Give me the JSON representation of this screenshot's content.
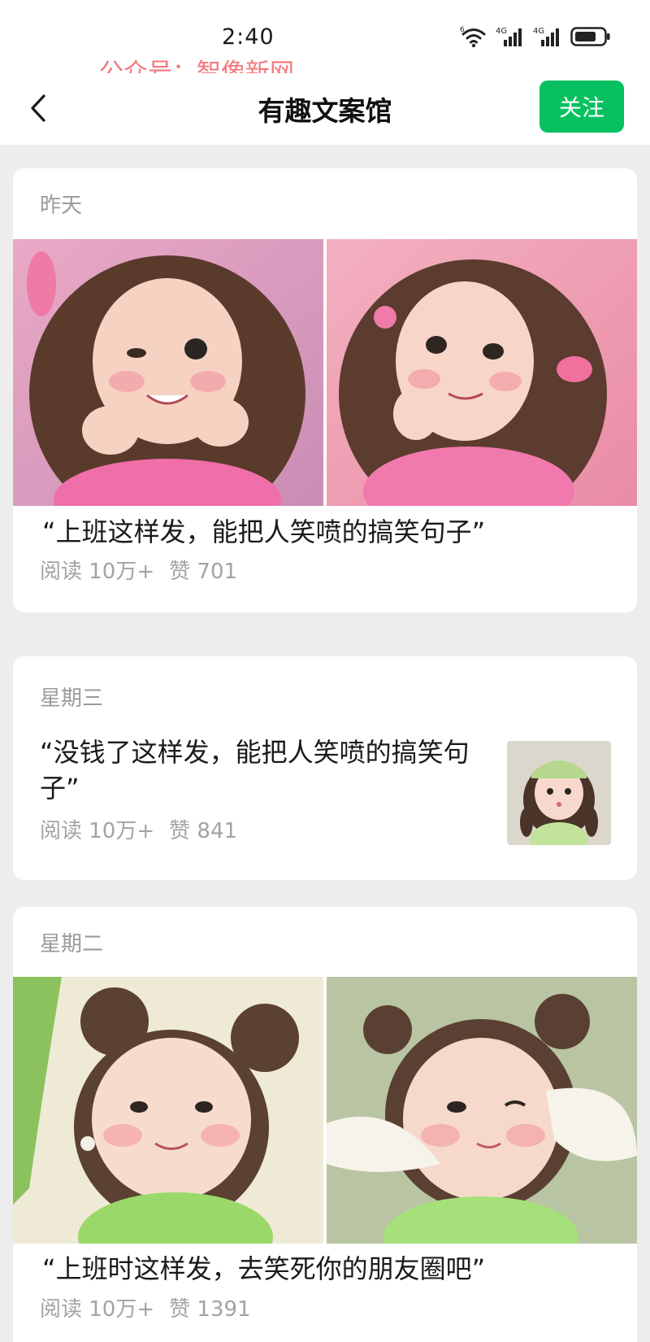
{
  "status_bar": {
    "time": "2:40",
    "wifi_badge": "6",
    "signal_1_label": "4G",
    "signal_2_label": "4G"
  },
  "watermark": "公众号：智像新网",
  "nav": {
    "title": "有趣文案馆",
    "follow_label": "关注"
  },
  "articles": [
    {
      "date": "昨天",
      "title": "“上班这样发，能把人笑喷的搞笑句子”",
      "reads": "阅读 10万+",
      "likes": "赞 701"
    },
    {
      "date": "星期三",
      "title": "“没钱了这样发，能把人笑喷的搞笑句子”",
      "reads": "阅读 10万+",
      "likes": "赞 841"
    },
    {
      "date": "星期二",
      "title": "“上班时这样发，去笑死你的朋友圈吧”",
      "reads": "阅读 10万+",
      "likes": "赞 1391"
    }
  ],
  "colors": {
    "accent": "#07c160",
    "watermark": "#f2777a",
    "page_bg": "#ededed"
  },
  "icons": {
    "back": "chevron-left-icon",
    "wifi": "wifi-icon",
    "signal": "signal-bars-icon",
    "battery": "battery-icon"
  }
}
